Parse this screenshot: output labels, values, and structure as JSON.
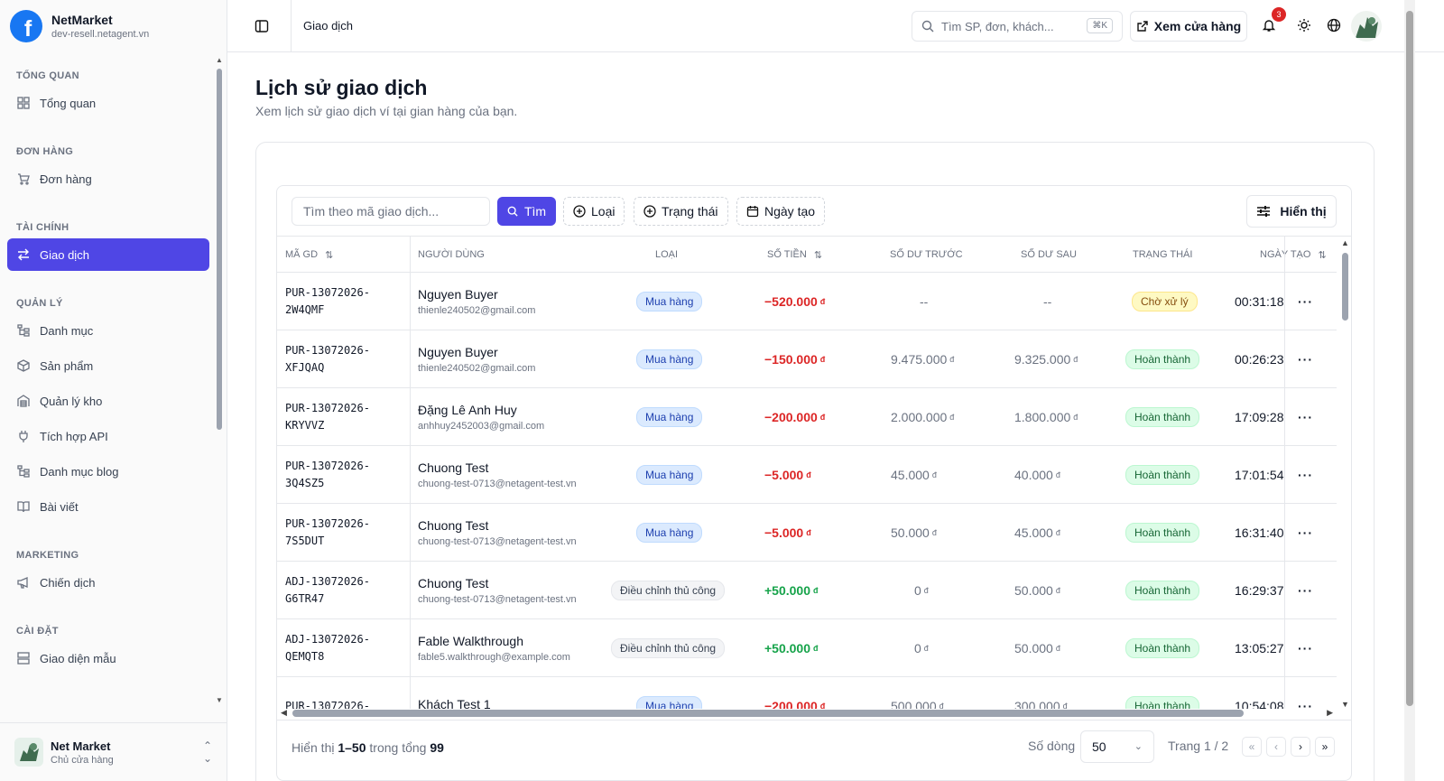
{
  "brand": {
    "name": "NetMarket",
    "domain": "dev-resell.netagent.vn"
  },
  "sidebar": {
    "sections": [
      {
        "heading": "TỔNG QUAN",
        "items": [
          {
            "label": "Tổng quan",
            "icon": "dashboard-icon"
          }
        ]
      },
      {
        "heading": "ĐƠN HÀNG",
        "items": [
          {
            "label": "Đơn hàng",
            "icon": "cart-icon"
          }
        ]
      },
      {
        "heading": "TÀI CHÍNH",
        "items": [
          {
            "label": "Giao dịch",
            "icon": "transaction-icon",
            "active": true
          }
        ]
      },
      {
        "heading": "QUẢN LÝ",
        "items": [
          {
            "label": "Danh mục",
            "icon": "tree-icon"
          },
          {
            "label": "Sản phẩm",
            "icon": "box-icon"
          },
          {
            "label": "Quản lý kho",
            "icon": "warehouse-icon"
          },
          {
            "label": "Tích hợp API",
            "icon": "plug-icon"
          },
          {
            "label": "Danh mục blog",
            "icon": "tree-icon"
          },
          {
            "label": "Bài viết",
            "icon": "book-icon"
          }
        ]
      },
      {
        "heading": "MARKETING",
        "items": [
          {
            "label": "Chiến dịch",
            "icon": "megaphone-icon"
          }
        ]
      },
      {
        "heading": "CÀI ĐẶT",
        "items": [
          {
            "label": "Giao diện mẫu",
            "icon": "layout-icon"
          }
        ]
      }
    ],
    "user": {
      "name": "Net Market",
      "role": "Chủ cửa hàng"
    }
  },
  "header": {
    "breadcrumb": "Giao dịch",
    "search_placeholder": "Tìm SP, đơn, khách...",
    "shortcut": "⌘K",
    "store_button": "Xem cửa hàng",
    "notification_count": "3"
  },
  "page": {
    "title": "Lịch sử giao dịch",
    "subtitle": "Xem lịch sử giao dịch ví tại gian hàng của bạn."
  },
  "toolbar": {
    "search_placeholder": "Tìm theo mã giao dịch...",
    "find_button": "Tìm",
    "filter_type": "Loại",
    "filter_status": "Trạng thái",
    "filter_date": "Ngày tạo",
    "display_button": "Hiển thị"
  },
  "columns": {
    "code": "MÃ GD",
    "user": "NGƯỜI DÙNG",
    "type": "LOẠI",
    "amount": "SỐ TIỀN",
    "before": "SỐ DƯ TRƯỚC",
    "after": "SỐ DƯ SAU",
    "status": "TRẠNG THÁI",
    "date": "NGÀY TẠO"
  },
  "rows": [
    {
      "code1": "PUR-13072026-",
      "code2": "2W4QMF",
      "name": "Nguyen Buyer",
      "email": "thienle240502@gmail.com",
      "type": "Mua hàng",
      "type_kind": "buy",
      "amount": "−520.000",
      "sign": "neg",
      "before": "--",
      "after": "--",
      "status": "Chờ xử lý",
      "status_kind": "pending",
      "time": "00:31:18"
    },
    {
      "code1": "PUR-13072026-",
      "code2": "XFJQAQ",
      "name": "Nguyen Buyer",
      "email": "thienle240502@gmail.com",
      "type": "Mua hàng",
      "type_kind": "buy",
      "amount": "−150.000",
      "sign": "neg",
      "before": "9.475.000",
      "after": "9.325.000",
      "status": "Hoàn thành",
      "status_kind": "done",
      "time": "00:26:23"
    },
    {
      "code1": "PUR-13072026-",
      "code2": "KRYVVZ",
      "name": "Đặng Lê Anh Huy",
      "email": "anhhuy2452003@gmail.com",
      "type": "Mua hàng",
      "type_kind": "buy",
      "amount": "−200.000",
      "sign": "neg",
      "before": "2.000.000",
      "after": "1.800.000",
      "status": "Hoàn thành",
      "status_kind": "done",
      "time": "17:09:28"
    },
    {
      "code1": "PUR-13072026-",
      "code2": "3Q4SZ5",
      "name": "Chuong Test",
      "email": "chuong-test-0713@netagent-test.vn",
      "type": "Mua hàng",
      "type_kind": "buy",
      "amount": "−5.000",
      "sign": "neg",
      "before": "45.000",
      "after": "40.000",
      "status": "Hoàn thành",
      "status_kind": "done",
      "time": "17:01:54"
    },
    {
      "code1": "PUR-13072026-",
      "code2": "7S5DUT",
      "name": "Chuong Test",
      "email": "chuong-test-0713@netagent-test.vn",
      "type": "Mua hàng",
      "type_kind": "buy",
      "amount": "−5.000",
      "sign": "neg",
      "before": "50.000",
      "after": "45.000",
      "status": "Hoàn thành",
      "status_kind": "done",
      "time": "16:31:40"
    },
    {
      "code1": "ADJ-13072026-",
      "code2": "G6TR47",
      "name": "Chuong Test",
      "email": "chuong-test-0713@netagent-test.vn",
      "type": "Điều chỉnh thủ công",
      "type_kind": "adj",
      "amount": "+50.000",
      "sign": "pos",
      "before": "0",
      "after": "50.000",
      "status": "Hoàn thành",
      "status_kind": "done",
      "time": "16:29:37"
    },
    {
      "code1": "ADJ-13072026-",
      "code2": "QEMQT8",
      "name": "Fable Walkthrough",
      "email": "fable5.walkthrough@example.com",
      "type": "Điều chỉnh thủ công",
      "type_kind": "adj",
      "amount": "+50.000",
      "sign": "pos",
      "before": "0",
      "after": "50.000",
      "status": "Hoàn thành",
      "status_kind": "done",
      "time": "13:05:27"
    },
    {
      "code1": "PUR-13072026-",
      "code2": "",
      "name": "Khách Test 1",
      "email": "",
      "type": "Mua hàng",
      "type_kind": "buy",
      "amount": "−200.000",
      "sign": "neg",
      "before": "500.000",
      "after": "300.000",
      "status": "Hoàn thành",
      "status_kind": "done",
      "time": "10:54:08"
    }
  ],
  "currency": "đ",
  "footer": {
    "showing_prefix": "Hiển thị",
    "range": "1–50",
    "in_total": "trong tổng",
    "total": "99",
    "rows_label": "Số dòng",
    "rows_value": "50",
    "page_label": "Trang 1 / 2"
  }
}
